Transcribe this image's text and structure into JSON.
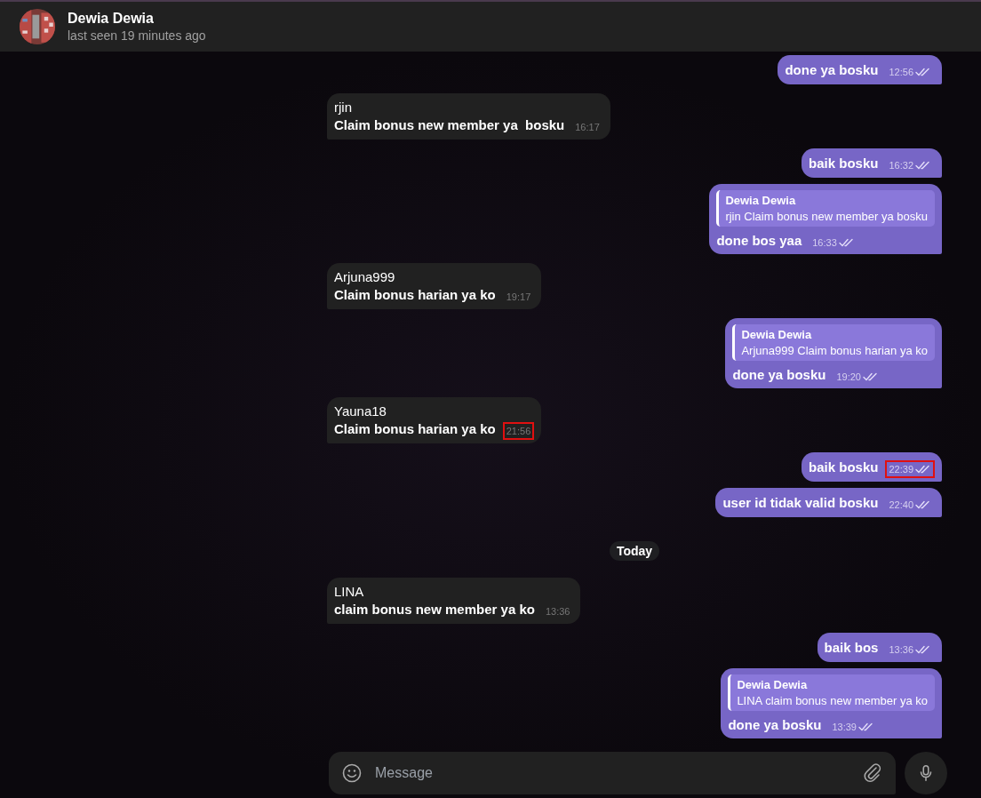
{
  "header": {
    "name": "Dewia Dewia",
    "status": "last seen 19 minutes ago"
  },
  "messages": [
    {
      "kind": "outgoing",
      "text": "done ya bosku",
      "time": "12:56",
      "read": true,
      "highlighted": false
    },
    {
      "kind": "incoming",
      "sender": "rjin",
      "text": "Claim bonus new member ya  bosku",
      "time": "16:17",
      "highlighted": false
    },
    {
      "kind": "outgoing",
      "text": "baik bosku",
      "time": "16:32",
      "read": true,
      "highlighted": false
    },
    {
      "kind": "outgoing",
      "reply": {
        "author": "Dewia Dewia",
        "text": "rjin Claim bonus new member ya bosku"
      },
      "text": "done bos yaa",
      "time": "16:33",
      "read": true,
      "highlighted": false
    },
    {
      "kind": "incoming",
      "sender": "Arjuna999",
      "text": "Claim bonus harian ya ko",
      "time": "19:17",
      "highlighted": false
    },
    {
      "kind": "outgoing",
      "reply": {
        "author": "Dewia Dewia",
        "text": "Arjuna999 Claim bonus harian ya ko"
      },
      "text": "done ya bosku",
      "time": "19:20",
      "read": true,
      "highlighted": false
    },
    {
      "kind": "incoming",
      "sender": "Yauna18",
      "text": "Claim bonus harian ya ko",
      "time": "21:56",
      "highlighted": true
    },
    {
      "kind": "outgoing",
      "text": "baik bosku",
      "time": "22:39",
      "read": true,
      "highlighted": true
    },
    {
      "kind": "outgoing",
      "text": "user id tidak valid bosku",
      "time": "22:40",
      "read": true,
      "highlighted": false
    },
    {
      "kind": "date",
      "text": "Today"
    },
    {
      "kind": "incoming",
      "sender": "LINA",
      "text": "claim bonus new member ya ko",
      "time": "13:36",
      "highlighted": false
    },
    {
      "kind": "outgoing",
      "text": "baik bos",
      "time": "13:36",
      "read": true,
      "highlighted": false
    },
    {
      "kind": "outgoing",
      "reply": {
        "author": "Dewia Dewia",
        "text": "LINA claim bonus new member ya ko"
      },
      "text": "done ya bosku",
      "time": "13:39",
      "read": true,
      "highlighted": false
    }
  ],
  "composer": {
    "placeholder": "Message"
  }
}
